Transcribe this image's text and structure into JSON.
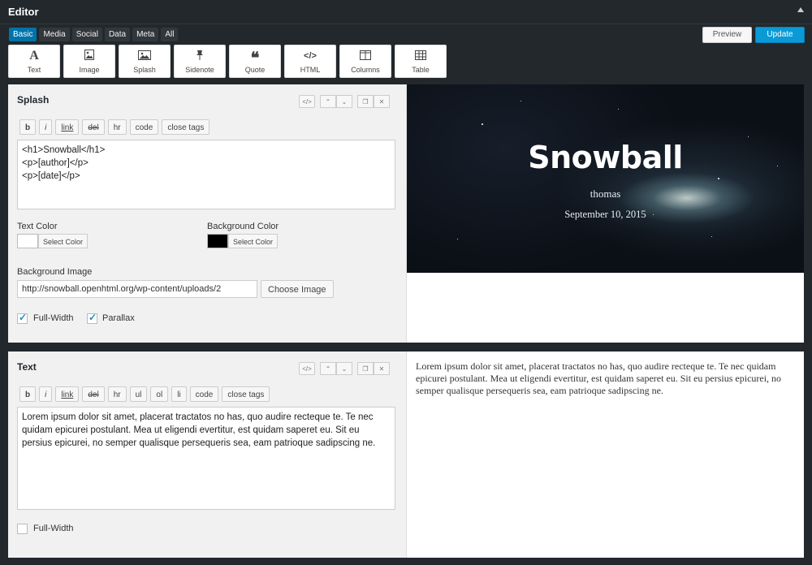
{
  "header": {
    "title": "Editor"
  },
  "categories": [
    "Basic",
    "Media",
    "Social",
    "Data",
    "Meta",
    "All"
  ],
  "actions": {
    "preview": "Preview",
    "update": "Update"
  },
  "widgets": [
    {
      "label": "Text",
      "icon": "text-icon"
    },
    {
      "label": "Image",
      "icon": "image-icon"
    },
    {
      "label": "Splash",
      "icon": "splash-icon"
    },
    {
      "label": "Sidenote",
      "icon": "pin-icon"
    },
    {
      "label": "Quote",
      "icon": "quote-icon"
    },
    {
      "label": "HTML",
      "icon": "code-icon"
    },
    {
      "label": "Columns",
      "icon": "columns-icon"
    },
    {
      "label": "Table",
      "icon": "table-icon"
    }
  ],
  "splash_panel": {
    "title": "Splash",
    "format_buttons": [
      "b",
      "i",
      "link",
      "del",
      "hr",
      "code",
      "close tags"
    ],
    "content": "<h1>Snowball</h1>\n<p>[author]</p>\n<p>[date]</p>",
    "text_color_label": "Text Color",
    "bg_color_label": "Background Color",
    "select_color": "Select Color",
    "text_color": "#ffffff",
    "bg_color": "#000000",
    "bg_image_label": "Background Image",
    "bg_image_url": "http://snowball.openhtml.org/wp-content/uploads/2",
    "choose_image": "Choose Image",
    "full_width_label": "Full-Width",
    "full_width": true,
    "parallax_label": "Parallax",
    "parallax": true
  },
  "text_panel": {
    "title": "Text",
    "format_buttons": [
      "b",
      "i",
      "link",
      "del",
      "hr",
      "ul",
      "ol",
      "li",
      "code",
      "close tags"
    ],
    "content": "Lorem ipsum dolor sit amet, placerat tractatos no has, quo audire recteque te. Te nec quidam epicurei postulant. Mea ut eligendi evertitur, est quidam saperet eu. Sit eu persius epicurei, no semper qualisque persequeris sea, eam patrioque sadipscing ne.",
    "full_width_label": "Full-Width",
    "full_width": false
  },
  "preview": {
    "splash_title": "Snowball",
    "splash_author": "thomas",
    "splash_date": "September 10, 2015",
    "text": "Lorem ipsum dolor sit amet, placerat tractatos no has, quo audire recteque te. Te nec quidam epicurei postulant. Mea ut eligendi evertitur, est quidam saperet eu. Sit eu persius epicurei, no semper qualisque persequeris sea, eam patrioque sadipscing ne."
  }
}
